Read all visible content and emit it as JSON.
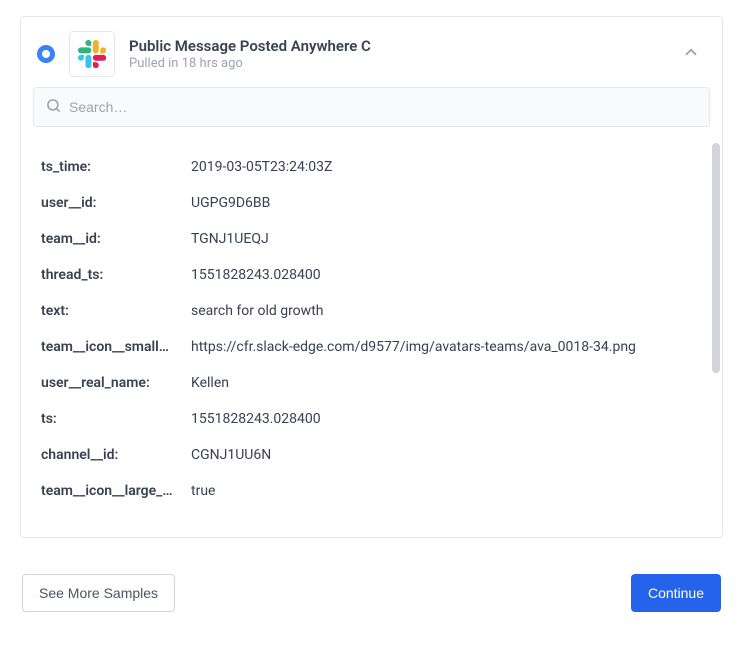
{
  "header": {
    "title": "Public Message Posted Anywhere C",
    "subtitle": "Pulled in 18 hrs ago",
    "app_icon": "slack-logo"
  },
  "search": {
    "placeholder": "Search…"
  },
  "fields": [
    {
      "key": "ts_time:",
      "value": "2019-03-05T23:24:03Z"
    },
    {
      "key": "user__id:",
      "value": "UGPG9D6BB"
    },
    {
      "key": "team__id:",
      "value": "TGNJ1UEQJ"
    },
    {
      "key": "thread_ts:",
      "value": "1551828243.028400"
    },
    {
      "key": "text:",
      "value": "search for old growth"
    },
    {
      "key": "team__icon__small…",
      "value": "https://cfr.slack-edge.com/d9577/img/avatars-teams/ava_0018-34.png"
    },
    {
      "key": "user__real_name:",
      "value": "Kellen"
    },
    {
      "key": "ts:",
      "value": "1551828243.028400"
    },
    {
      "key": "channel__id:",
      "value": "CGNJ1UU6N"
    },
    {
      "key": "team__icon__large_…",
      "value": "true"
    }
  ],
  "footer": {
    "see_more": "See More Samples",
    "continue": "Continue"
  }
}
